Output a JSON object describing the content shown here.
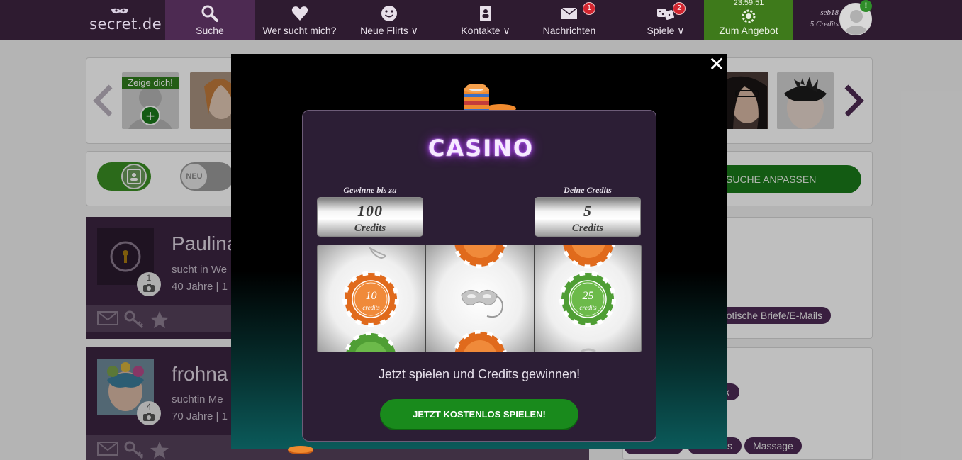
{
  "nav": {
    "logo": "secret.de",
    "items": [
      {
        "label": "Suche",
        "icon": "search-icon"
      },
      {
        "label": "Wer sucht mich?",
        "icon": "heart-icon"
      },
      {
        "label": "Neue Flirts",
        "icon": "smiley-icon"
      },
      {
        "label": "Kontakte",
        "icon": "contacts-book-icon"
      },
      {
        "label": "Nachrichten",
        "icon": "envelope-icon",
        "badge": "1"
      },
      {
        "label": "Spiele",
        "icon": "dice-icon",
        "badge": "2"
      }
    ],
    "dropdown_arrow": "∨",
    "offer": {
      "timer": "23:59:51",
      "label": "Zum Angebot"
    },
    "user": {
      "name": "seb18",
      "credits": "5 Credits",
      "alert": "!"
    }
  },
  "page": {
    "gallery": {
      "zeige_label": "Zeige dich!",
      "plus": "+"
    },
    "filters": {
      "neu_label": "NEU",
      "suche_label": "SUCHE ANPASSEN"
    },
    "profiles": [
      {
        "name": "Paulina",
        "sub": "sucht in We",
        "age": "40 Jahre | 1",
        "photos": "1"
      },
      {
        "name": "frohna",
        "sub": "suchtin Me",
        "age": "70 Jahre | 1",
        "photos": "4"
      }
    ],
    "tags": [
      "rotische Briefe/E-Mails",
      "x",
      "s",
      "Massage"
    ]
  },
  "modal": {
    "close": "✕",
    "title": "CASINO",
    "win_label": "Gewinne bis zu",
    "win_value": "100",
    "win_unit": "Credits",
    "credits_label": "Deine Credits",
    "credits_value": "5",
    "credits_unit": "Credits",
    "reel_chips": {
      "left_center": "10",
      "right_center": "25"
    },
    "chip_word": "credits",
    "promo": "Jetzt spielen und Credits gewinnen!",
    "play_button": "JETZT KOSTENLOS SPIELEN!"
  },
  "colors": {
    "nav_bg": "#2e1b30",
    "accent_green": "#198a1c",
    "casino_bg": "#2c1e35",
    "chip_orange": "#e06a1c",
    "chip_green": "#4f9e34"
  }
}
